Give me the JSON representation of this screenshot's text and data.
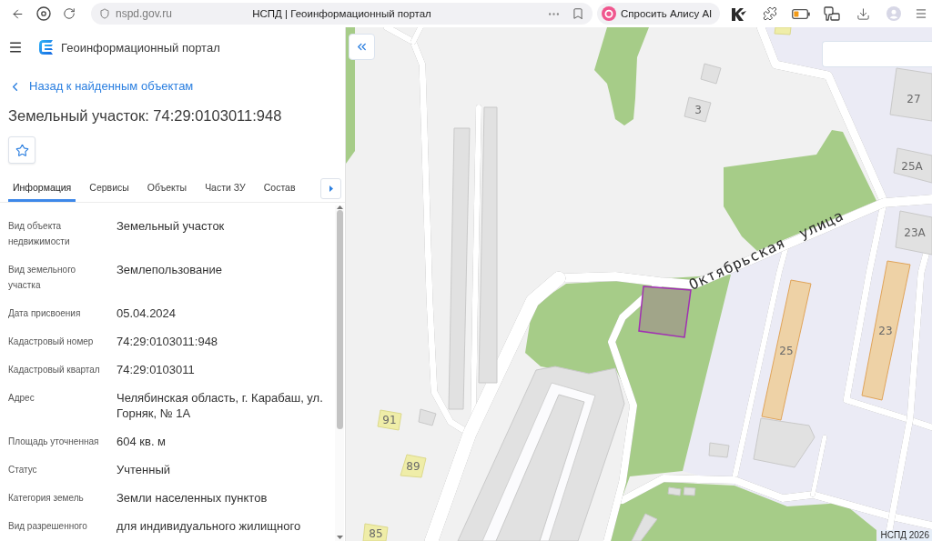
{
  "browser": {
    "url": "nspd.gov.ru",
    "page_title": "НСПД | Геоинформационный портал",
    "assistant_button": "Спросить Алису AI"
  },
  "header": {
    "title": "Геоинформационный портал"
  },
  "back_link": "Назад к найденным объектам",
  "object_title": "Земельный участок: 74:29:0103011:948",
  "tabs": [
    {
      "label": "Информация",
      "selected": true
    },
    {
      "label": "Сервисы",
      "selected": false
    },
    {
      "label": "Объекты",
      "selected": false
    },
    {
      "label": "Части ЗУ",
      "selected": false
    },
    {
      "label": "Состав",
      "selected": false
    }
  ],
  "properties": [
    {
      "label": "Вид объекта недвижимости",
      "value": "Земельный участок"
    },
    {
      "label": "Вид земельного участка",
      "value": "Землепользование"
    },
    {
      "label": "Дата присвоения",
      "value": "05.04.2024"
    },
    {
      "label": "Кадастровый номер",
      "value": "74:29:0103011:948"
    },
    {
      "label": "Кадастровый квартал",
      "value": "74:29:0103011"
    },
    {
      "label": "Адрес",
      "value": "Челябинская область, г. Карабаш, ул. Горняк, № 1А"
    },
    {
      "label": "Площадь уточненная",
      "value": "604 кв. м"
    },
    {
      "label": "Статус",
      "value": "Учтенный"
    },
    {
      "label": "Категория земель",
      "value": "Земли населенных пунктов"
    },
    {
      "label": "Вид разрешенного",
      "value": "для индивидуального жилищного"
    }
  ],
  "map": {
    "street_name": "Октябрьская улица",
    "building_numbers": [
      "3",
      "27",
      "25А",
      "23А",
      "25",
      "23",
      "91",
      "89",
      "85"
    ],
    "attribution": "НСПД 2026"
  }
}
